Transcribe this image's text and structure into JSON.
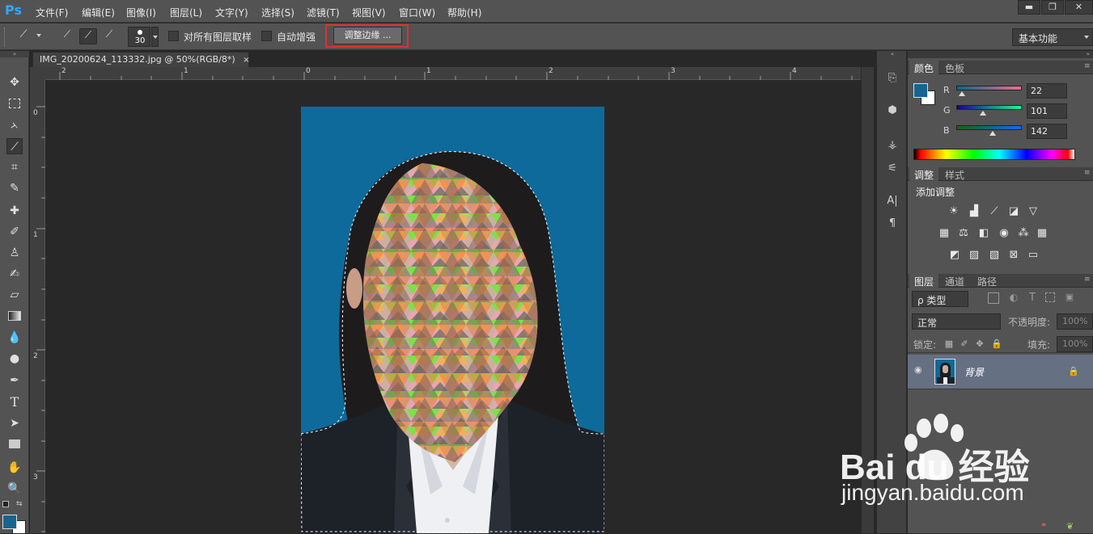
{
  "app": {
    "logo": "Ps"
  },
  "menu": [
    "文件(F)",
    "编辑(E)",
    "图像(I)",
    "图层(L)",
    "文字(Y)",
    "选择(S)",
    "滤镜(T)",
    "视图(V)",
    "窗口(W)",
    "帮助(H)"
  ],
  "window_controls": {
    "minimize": "▬",
    "restore": "❐",
    "close": "✕"
  },
  "options": {
    "brush_size": "30",
    "sample_all_layers": "对所有图层取样",
    "auto_enhance": "自动增强",
    "refine_edge": "调整边缘 ...",
    "workspace": "基本功能"
  },
  "document": {
    "tab_title": "IMG_20200624_113332.jpg @ 50%(RGB/8*)",
    "close": "×"
  },
  "rulers": {
    "horizontal": [
      "2",
      "1",
      "0",
      "1",
      "2",
      "3",
      "4"
    ],
    "vertical": [
      "0",
      "1",
      "2",
      "3"
    ]
  },
  "color_panel": {
    "tabs": [
      "颜色",
      "色板"
    ],
    "channels": [
      {
        "label": "R",
        "value": "22"
      },
      {
        "label": "G",
        "value": "101"
      },
      {
        "label": "B",
        "value": "142"
      }
    ],
    "foreground": "#16658e",
    "background": "#ffffff"
  },
  "adjust_panel": {
    "tabs": [
      "调整",
      "样式"
    ],
    "title": "添加调整"
  },
  "layers_panel": {
    "tabs": [
      "图层",
      "通道",
      "路径"
    ],
    "filter": "ρ 类型",
    "blend_mode": "正常",
    "opacity_label": "不透明度:",
    "opacity_value": "100%",
    "lock_label": "锁定:",
    "fill_label": "填充:",
    "fill_value": "100%",
    "layers": [
      {
        "name": "背景",
        "locked": true,
        "visible": true
      }
    ]
  },
  "watermark": {
    "brand": "Bai du 经验",
    "url": "jingyan.baidu.com"
  }
}
